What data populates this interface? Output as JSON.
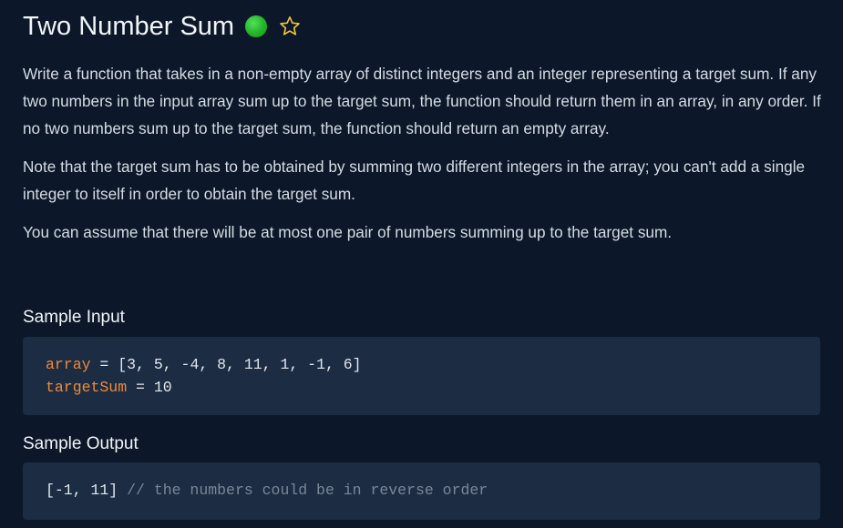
{
  "problem": {
    "title": "Two Number Sum",
    "difficulty_color": "#2ec235",
    "star_color": "#f3c43b",
    "paragraphs": [
      "Write a function that takes in a non-empty array of distinct integers and an integer representing a target sum. If any two numbers in the input array sum up to the target sum, the function should return them in an array, in any order. If no two numbers sum up to the target sum, the function should return an empty array.",
      "Note that the target sum has to be obtained by summing two different integers in the array; you can't add a single integer to itself in order to obtain the target sum.",
      "You can assume that there will be at most one pair of numbers summing up to the target sum."
    ]
  },
  "sample_input": {
    "heading": "Sample Input",
    "lines": [
      {
        "name": "array",
        "op": " = ",
        "value": "[3, 5, -4, 8, 11, 1, -1, 6]"
      },
      {
        "name": "targetSum",
        "op": " = ",
        "value": "10"
      }
    ]
  },
  "sample_output": {
    "heading": "Sample Output",
    "value": "[-1, 11]",
    "comment": " // the numbers could be in reverse order"
  },
  "icons": {
    "difficulty": "difficulty-dot-icon",
    "star": "star-outline-icon"
  }
}
